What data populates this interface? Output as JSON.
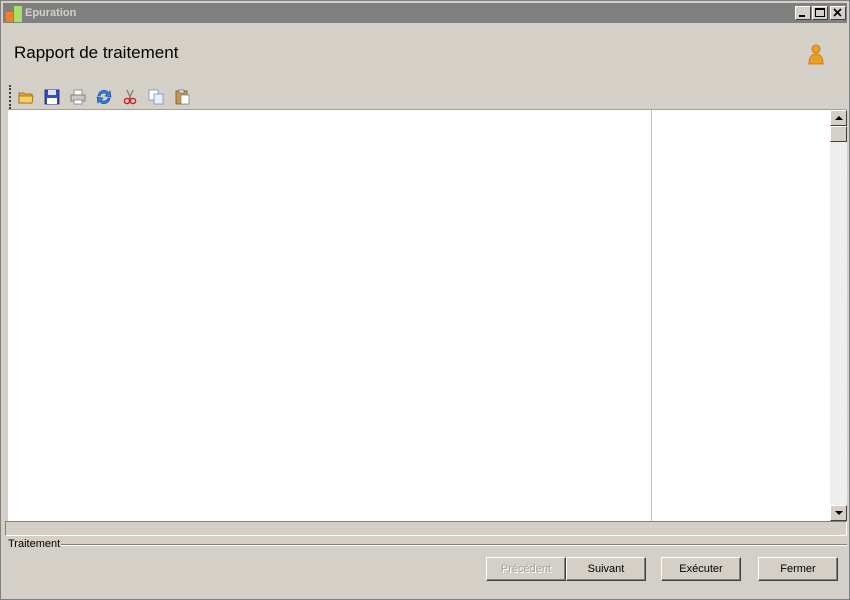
{
  "window": {
    "title": "Epuration"
  },
  "header": {
    "title": "Rapport de traitement"
  },
  "toolbar": {
    "buttons": [
      "open-icon",
      "save-icon",
      "print-icon",
      "refresh-icon",
      "cut-icon",
      "copy-icon",
      "paste-icon"
    ]
  },
  "group": {
    "label": "Traitement"
  },
  "buttons": {
    "previous": "Précédent",
    "next": "Suivant",
    "execute": "Exécuter",
    "close": "Fermer"
  },
  "colors": {
    "titlebar": "#808080",
    "window_bg": "#d4d0c8",
    "accent_orange": "#f0a020"
  }
}
